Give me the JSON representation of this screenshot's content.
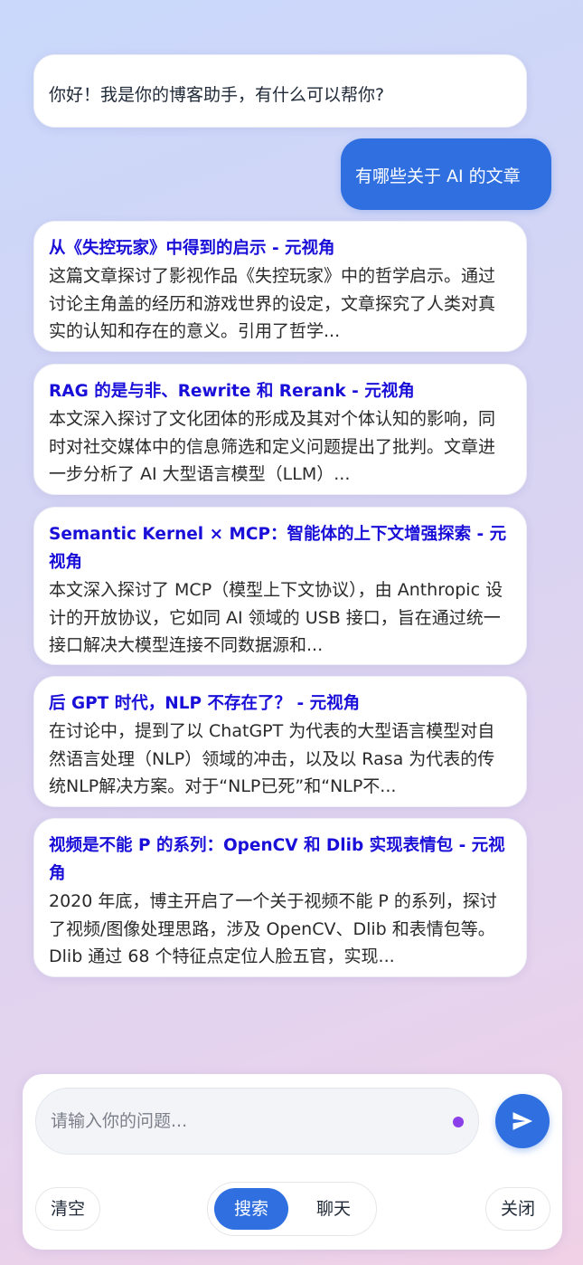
{
  "messages": {
    "greeting": "你好！我是你的博客助手，有什么可以帮你?",
    "user_query": "有哪些关于 AI 的文章"
  },
  "results": [
    {
      "title": "从《失控玩家》中得到的启示 - 元视角",
      "desc": "这篇文章探讨了影视作品《失控玩家》中的哲学启示。通过讨论主角盖的经历和游戏世界的设定，文章探究了人类对真实的认知和存在的意义。引用了哲学..."
    },
    {
      "title": "RAG 的是与非、Rewrite 和 Rerank - 元视角",
      "desc": "本文深入探讨了文化团体的形成及其对个体认知的影响，同时对社交媒体中的信息筛选和定义问题提出了批判。文章进一步分析了 AI 大型语言模型（LLM）..."
    },
    {
      "title": "Semantic Kernel × MCP：智能体的上下文增强探索 - 元视角",
      "desc": "本文深入探讨了 MCP（模型上下文协议），由 Anthropic 设计的开放协议，它如同 AI 领域的 USB 接口，旨在通过统一接口解决大模型连接不同数据源和..."
    },
    {
      "title": "后 GPT 时代，NLP 不存在了？ - 元视角",
      "desc": "在讨论中，提到了以 ChatGPT 为代表的大型语言模型对自然语言处理（NLP）领域的冲击，以及以 Rasa 为代表的传统NLP解决方案。对于“NLP已死”和“NLP不..."
    },
    {
      "title": "视频是不能 P 的系列：OpenCV 和 Dlib 实现表情包 - 元视角",
      "desc": "2020 年底，博主开启了一个关于视频不能 P 的系列，探讨了视频/图像处理思路，涉及 OpenCV、Dlib 和表情包等。Dlib 通过 68 个特征点定位人脸五官，实现..."
    }
  ],
  "composer": {
    "placeholder": "请输入你的问题...",
    "clear_label": "清空",
    "mode_search_label": "搜索",
    "mode_chat_label": "聊天",
    "active_mode": "搜索",
    "close_label": "关闭",
    "send_icon": "send-icon"
  },
  "colors": {
    "accent": "#2f6fe0",
    "link_title": "#1a0fd8",
    "status_dot": "#8b3fe8"
  }
}
